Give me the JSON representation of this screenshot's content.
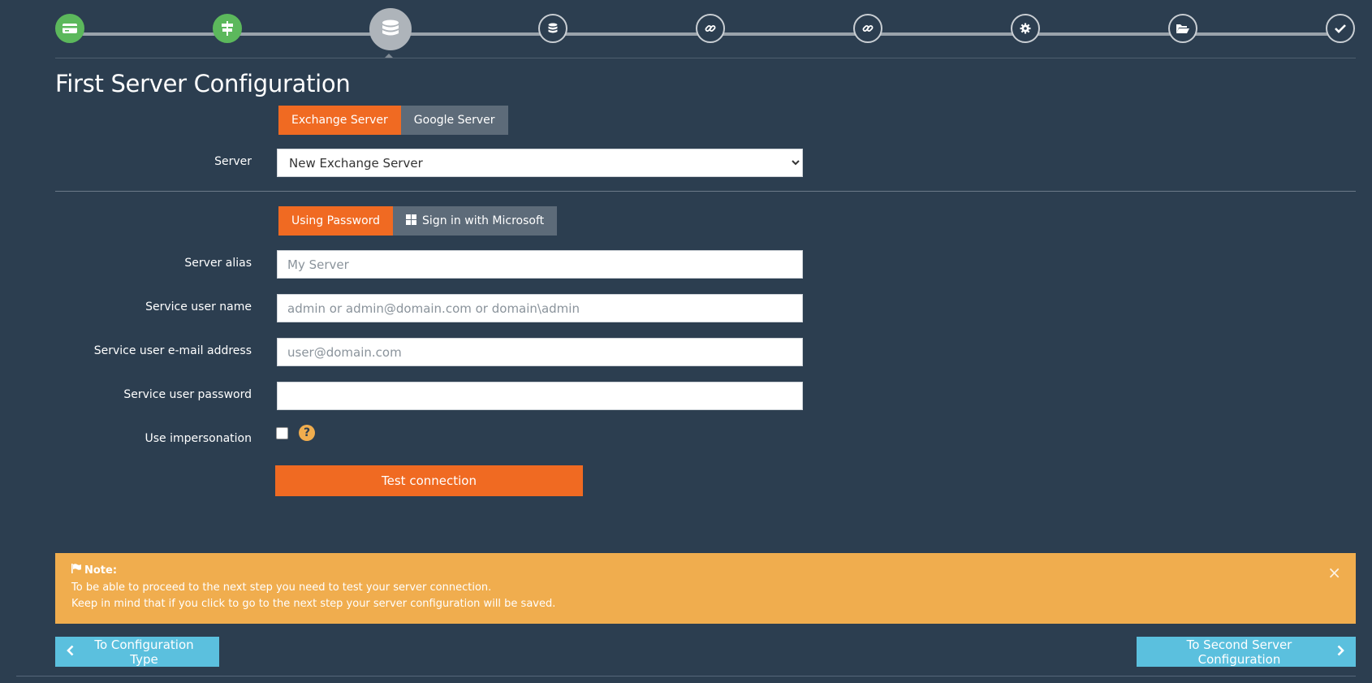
{
  "stepper": {
    "steps": [
      {
        "icon": "credit-card-icon",
        "state": "done"
      },
      {
        "icon": "signpost-icon",
        "state": "done"
      },
      {
        "icon": "database-icon",
        "state": "active"
      },
      {
        "icon": "database-icon",
        "state": "todo"
      },
      {
        "icon": "link-icon",
        "state": "todo"
      },
      {
        "icon": "link-icon",
        "state": "todo"
      },
      {
        "icon": "gear-icon",
        "state": "todo"
      },
      {
        "icon": "folder-open-icon",
        "state": "todo"
      },
      {
        "icon": "checkmark-icon",
        "state": "todo"
      }
    ]
  },
  "page": {
    "title": "First Server Configuration"
  },
  "server_type": {
    "exchange_label": "Exchange Server",
    "google_label": "Google Server",
    "selected": "Exchange Server"
  },
  "server": {
    "label": "Server",
    "value": "New Exchange Server",
    "options": [
      "New Exchange Server"
    ]
  },
  "auth_method": {
    "password_label": "Using Password",
    "microsoft_label": "Sign in with Microsoft",
    "selected": "Using Password"
  },
  "form": {
    "alias": {
      "label": "Server alias",
      "placeholder": "My Server",
      "value": ""
    },
    "username": {
      "label": "Service user name",
      "placeholder": "admin or admin@domain.com or domain\\admin",
      "value": ""
    },
    "email": {
      "label": "Service user e-mail address",
      "placeholder": "user@domain.com",
      "value": ""
    },
    "password": {
      "label": "Service user password",
      "placeholder": "",
      "value": ""
    },
    "impersonation": {
      "label": "Use impersonation",
      "checked": false,
      "help": "?"
    }
  },
  "test_button": "Test connection",
  "note": {
    "title": "Note:",
    "line1": "To be able to proceed to the next step you need to test your server connection.",
    "line2": "Keep in mind that if you click to go to the next step your server configuration will be saved.",
    "close": "×"
  },
  "nav": {
    "back": "To Configuration Type",
    "next": "To Second Server Configuration"
  },
  "colors": {
    "background": "#2c3e50",
    "accent": "#f06a22",
    "done": "#5cb85c",
    "note": "#f0ad4e",
    "nav": "#5bc0de"
  }
}
